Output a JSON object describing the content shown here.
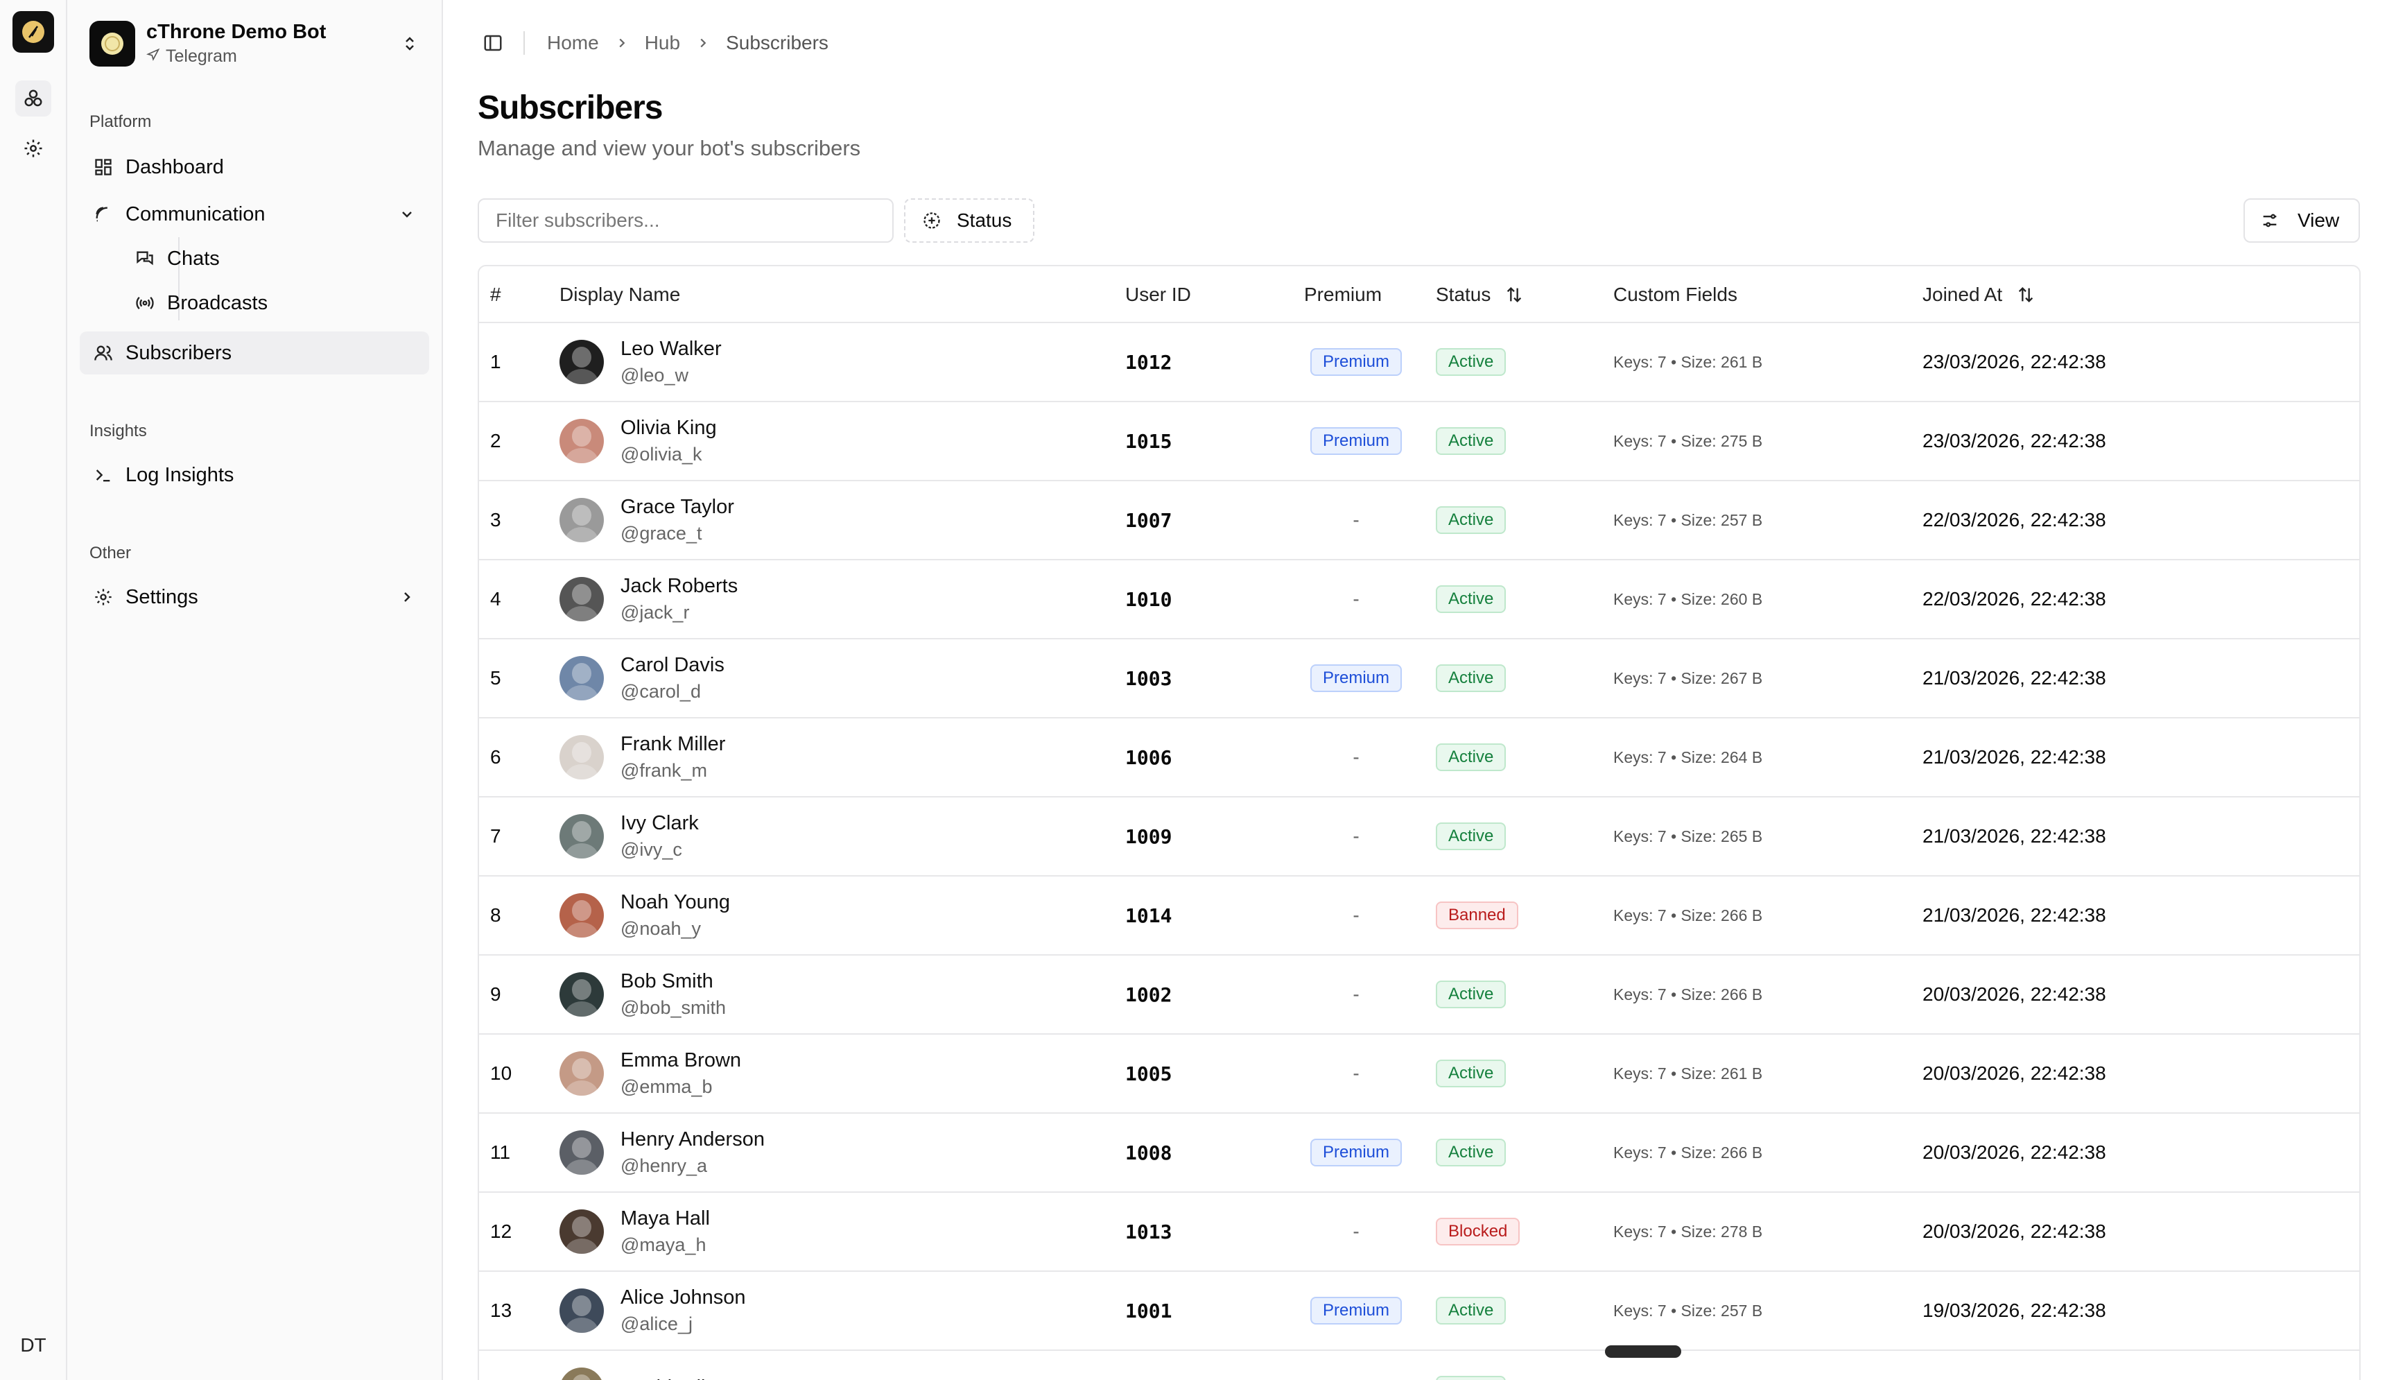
{
  "rail": {
    "user_initials": "DT"
  },
  "bot": {
    "name": "cThrone Demo Bot",
    "platform": "Telegram"
  },
  "sidebar": {
    "platform_label": "Platform",
    "dashboard": "Dashboard",
    "communication": "Communication",
    "chats": "Chats",
    "broadcasts": "Broadcasts",
    "subscribers": "Subscribers",
    "insights_label": "Insights",
    "log_insights": "Log Insights",
    "other_label": "Other",
    "settings": "Settings"
  },
  "breadcrumb": {
    "home": "Home",
    "hub": "Hub",
    "current": "Subscribers"
  },
  "page": {
    "title": "Subscribers",
    "subtitle": "Manage and view your bot's subscribers"
  },
  "toolbar": {
    "filter_placeholder": "Filter subscribers...",
    "status_label": "Status",
    "view_label": "View"
  },
  "table": {
    "headers": {
      "num": "#",
      "display_name": "Display Name",
      "user_id": "User ID",
      "premium": "Premium",
      "status": "Status",
      "custom_fields": "Custom Fields",
      "joined_at": "Joined At"
    },
    "rows": [
      {
        "num": "1",
        "name": "Leo Walker",
        "handle": "@leo_w",
        "uid": "1012",
        "premium": "Premium",
        "status": "Active",
        "cf": "Keys: 7 • Size: 261 B",
        "joined": "23/03/2026, 22:42:38",
        "avatar_color": "#1f1f1f"
      },
      {
        "num": "2",
        "name": "Olivia King",
        "handle": "@olivia_k",
        "uid": "1015",
        "premium": "Premium",
        "status": "Active",
        "cf": "Keys: 7 • Size: 275 B",
        "joined": "23/03/2026, 22:42:38",
        "avatar_color": "#c98a7a"
      },
      {
        "num": "3",
        "name": "Grace Taylor",
        "handle": "@grace_t",
        "uid": "1007",
        "premium": "-",
        "status": "Active",
        "cf": "Keys: 7 • Size: 257 B",
        "joined": "22/03/2026, 22:42:38",
        "avatar_color": "#9a9a9a"
      },
      {
        "num": "4",
        "name": "Jack Roberts",
        "handle": "@jack_r",
        "uid": "1010",
        "premium": "-",
        "status": "Active",
        "cf": "Keys: 7 • Size: 260 B",
        "joined": "22/03/2026, 22:42:38",
        "avatar_color": "#555555"
      },
      {
        "num": "5",
        "name": "Carol Davis",
        "handle": "@carol_d",
        "uid": "1003",
        "premium": "Premium",
        "status": "Active",
        "cf": "Keys: 7 • Size: 267 B",
        "joined": "21/03/2026, 22:42:38",
        "avatar_color": "#6f87a8"
      },
      {
        "num": "6",
        "name": "Frank Miller",
        "handle": "@frank_m",
        "uid": "1006",
        "premium": "-",
        "status": "Active",
        "cf": "Keys: 7 • Size: 264 B",
        "joined": "21/03/2026, 22:42:38",
        "avatar_color": "#d9d2cc"
      },
      {
        "num": "7",
        "name": "Ivy Clark",
        "handle": "@ivy_c",
        "uid": "1009",
        "premium": "-",
        "status": "Active",
        "cf": "Keys: 7 • Size: 265 B",
        "joined": "21/03/2026, 22:42:38",
        "avatar_color": "#6d7a78"
      },
      {
        "num": "8",
        "name": "Noah Young",
        "handle": "@noah_y",
        "uid": "1014",
        "premium": "-",
        "status": "Banned",
        "cf": "Keys: 7 • Size: 266 B",
        "joined": "21/03/2026, 22:42:38",
        "avatar_color": "#b5624a"
      },
      {
        "num": "9",
        "name": "Bob Smith",
        "handle": "@bob_smith",
        "uid": "1002",
        "premium": "-",
        "status": "Active",
        "cf": "Keys: 7 • Size: 266 B",
        "joined": "20/03/2026, 22:42:38",
        "avatar_color": "#2d3a3a"
      },
      {
        "num": "10",
        "name": "Emma Brown",
        "handle": "@emma_b",
        "uid": "1005",
        "premium": "-",
        "status": "Active",
        "cf": "Keys: 7 • Size: 261 B",
        "joined": "20/03/2026, 22:42:38",
        "avatar_color": "#c49a86"
      },
      {
        "num": "11",
        "name": "Henry Anderson",
        "handle": "@henry_a",
        "uid": "1008",
        "premium": "Premium",
        "status": "Active",
        "cf": "Keys: 7 • Size: 266 B",
        "joined": "20/03/2026, 22:42:38",
        "avatar_color": "#5b5f66"
      },
      {
        "num": "12",
        "name": "Maya Hall",
        "handle": "@maya_h",
        "uid": "1013",
        "premium": "-",
        "status": "Blocked",
        "cf": "Keys: 7 • Size: 278 B",
        "joined": "20/03/2026, 22:42:38",
        "avatar_color": "#4a3a30"
      },
      {
        "num": "13",
        "name": "Alice Johnson",
        "handle": "@alice_j",
        "uid": "1001",
        "premium": "Premium",
        "status": "Active",
        "cf": "Keys: 7 • Size: 257 B",
        "joined": "19/03/2026, 22:42:38",
        "avatar_color": "#3e4a5a"
      },
      {
        "num": "",
        "name": "David Wilson",
        "handle": "",
        "uid": "",
        "premium": "",
        "status": "Active",
        "cf": "",
        "joined": "",
        "avatar_color": "#8a7a5a"
      }
    ]
  }
}
